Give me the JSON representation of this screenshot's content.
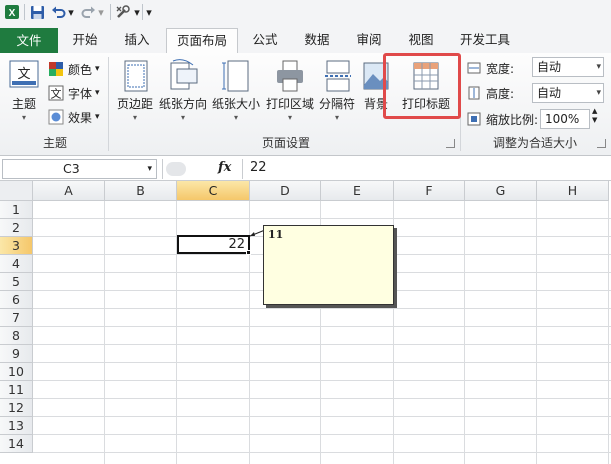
{
  "qat": {
    "app_icon": "excel-icon",
    "save_icon": "save-icon",
    "undo_icon": "undo-icon",
    "redo_icon": "redo-icon",
    "customize_icon": "tools-icon"
  },
  "tabs": [
    {
      "label": "文件"
    },
    {
      "label": "开始"
    },
    {
      "label": "插入"
    },
    {
      "label": "页面布局"
    },
    {
      "label": "公式"
    },
    {
      "label": "数据"
    },
    {
      "label": "审阅"
    },
    {
      "label": "视图"
    },
    {
      "label": "开发工具"
    }
  ],
  "ribbon": {
    "theme_group": {
      "label": "主题",
      "theme_button": "主题",
      "colors": "颜色",
      "fonts": "字体",
      "effects": "效果"
    },
    "page_setup_group": {
      "label": "页面设置",
      "buttons": [
        {
          "label": "页边距"
        },
        {
          "label": "纸张方向"
        },
        {
          "label": "纸张大小"
        },
        {
          "label": "打印区域"
        },
        {
          "label": "分隔符"
        },
        {
          "label": "背景"
        },
        {
          "label": "打印标题"
        }
      ]
    },
    "scale_group": {
      "label": "调整为合适大小",
      "width_label": "宽度:",
      "width_value": "自动",
      "height_label": "高度:",
      "height_value": "自动",
      "scale_label": "缩放比例:",
      "scale_value": "100%"
    }
  },
  "formula_bar": {
    "name_box": "C3",
    "fx": "fx",
    "value": "22"
  },
  "grid": {
    "columns": [
      "A",
      "B",
      "C",
      "D",
      "E",
      "F",
      "G",
      "H"
    ],
    "rows": [
      "1",
      "2",
      "3",
      "4",
      "5",
      "6",
      "7",
      "8",
      "9",
      "10",
      "11",
      "12",
      "13",
      "14"
    ],
    "active_cell": "C3",
    "active_value": "22",
    "comment_text": "11"
  },
  "colors": {
    "file_tab": "#1f7b3f",
    "highlight": "#e04a4a",
    "selected_header": "#f5c76a",
    "comment_bg": "#ffffe1"
  }
}
